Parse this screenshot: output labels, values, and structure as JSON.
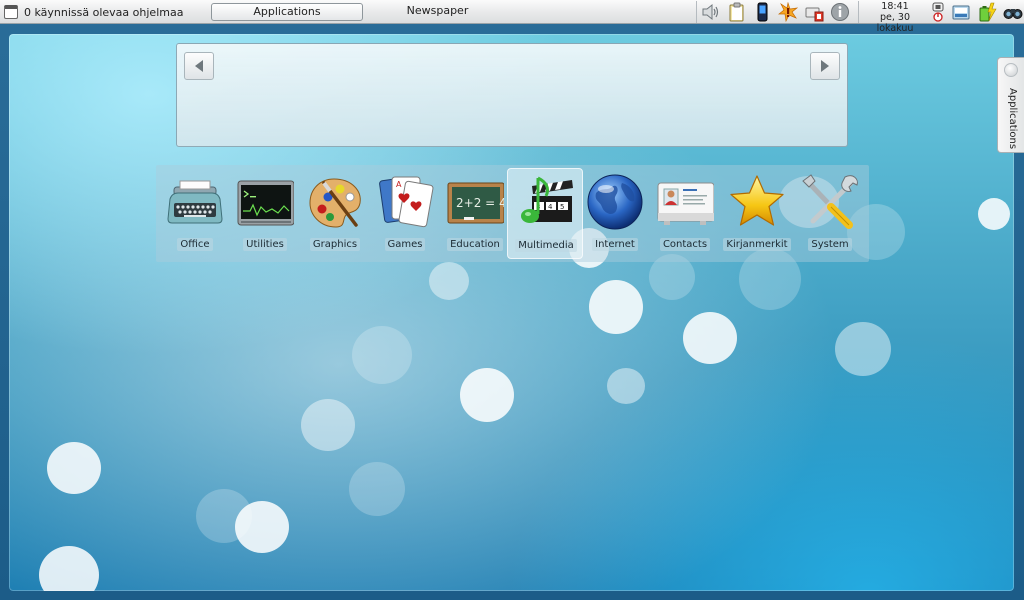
{
  "panel": {
    "running_programs": "0 käynnissä olevaa ohjelmaa",
    "applications_button": "Applications",
    "newspaper_label": "Newspaper",
    "clock": {
      "time": "18:41",
      "date": "pe, 30 lokakuu"
    },
    "tray_icons": [
      "speaker-icon",
      "clipboard-icon",
      "phone-icon",
      "network-alert-icon",
      "battery-monitor-icon",
      "info-icon",
      "power-icon",
      "update-manager-icon",
      "battery-charging-icon",
      "binoculars-icon"
    ]
  },
  "newspaper": {
    "prev_icon": "arrow-left-icon",
    "next_icon": "arrow-right-icon"
  },
  "launcher": {
    "selected": "Multimedia",
    "items": [
      {
        "label": "Office",
        "icon": "typewriter-icon"
      },
      {
        "label": "Utilities",
        "icon": "terminal-icon"
      },
      {
        "label": "Graphics",
        "icon": "palette-icon"
      },
      {
        "label": "Games",
        "icon": "playing-cards-icon"
      },
      {
        "label": "Education",
        "icon": "chalkboard-icon"
      },
      {
        "label": "Multimedia",
        "icon": "clapperboard-note-icon"
      },
      {
        "label": "Internet",
        "icon": "globe-icon"
      },
      {
        "label": "Contacts",
        "icon": "id-card-icon"
      },
      {
        "label": "Kirjanmerkit",
        "icon": "star-icon"
      },
      {
        "label": "System",
        "icon": "tools-icon"
      }
    ]
  },
  "side_tab": {
    "label": "Applications"
  },
  "chalkboard_text": "2+2 = 4",
  "colors": {
    "desktop_top": "#6ccbe0",
    "desktop_bottom": "#1e7fb3",
    "panel_bg": "#e8e9ea",
    "label_text": "#1b2a33"
  }
}
